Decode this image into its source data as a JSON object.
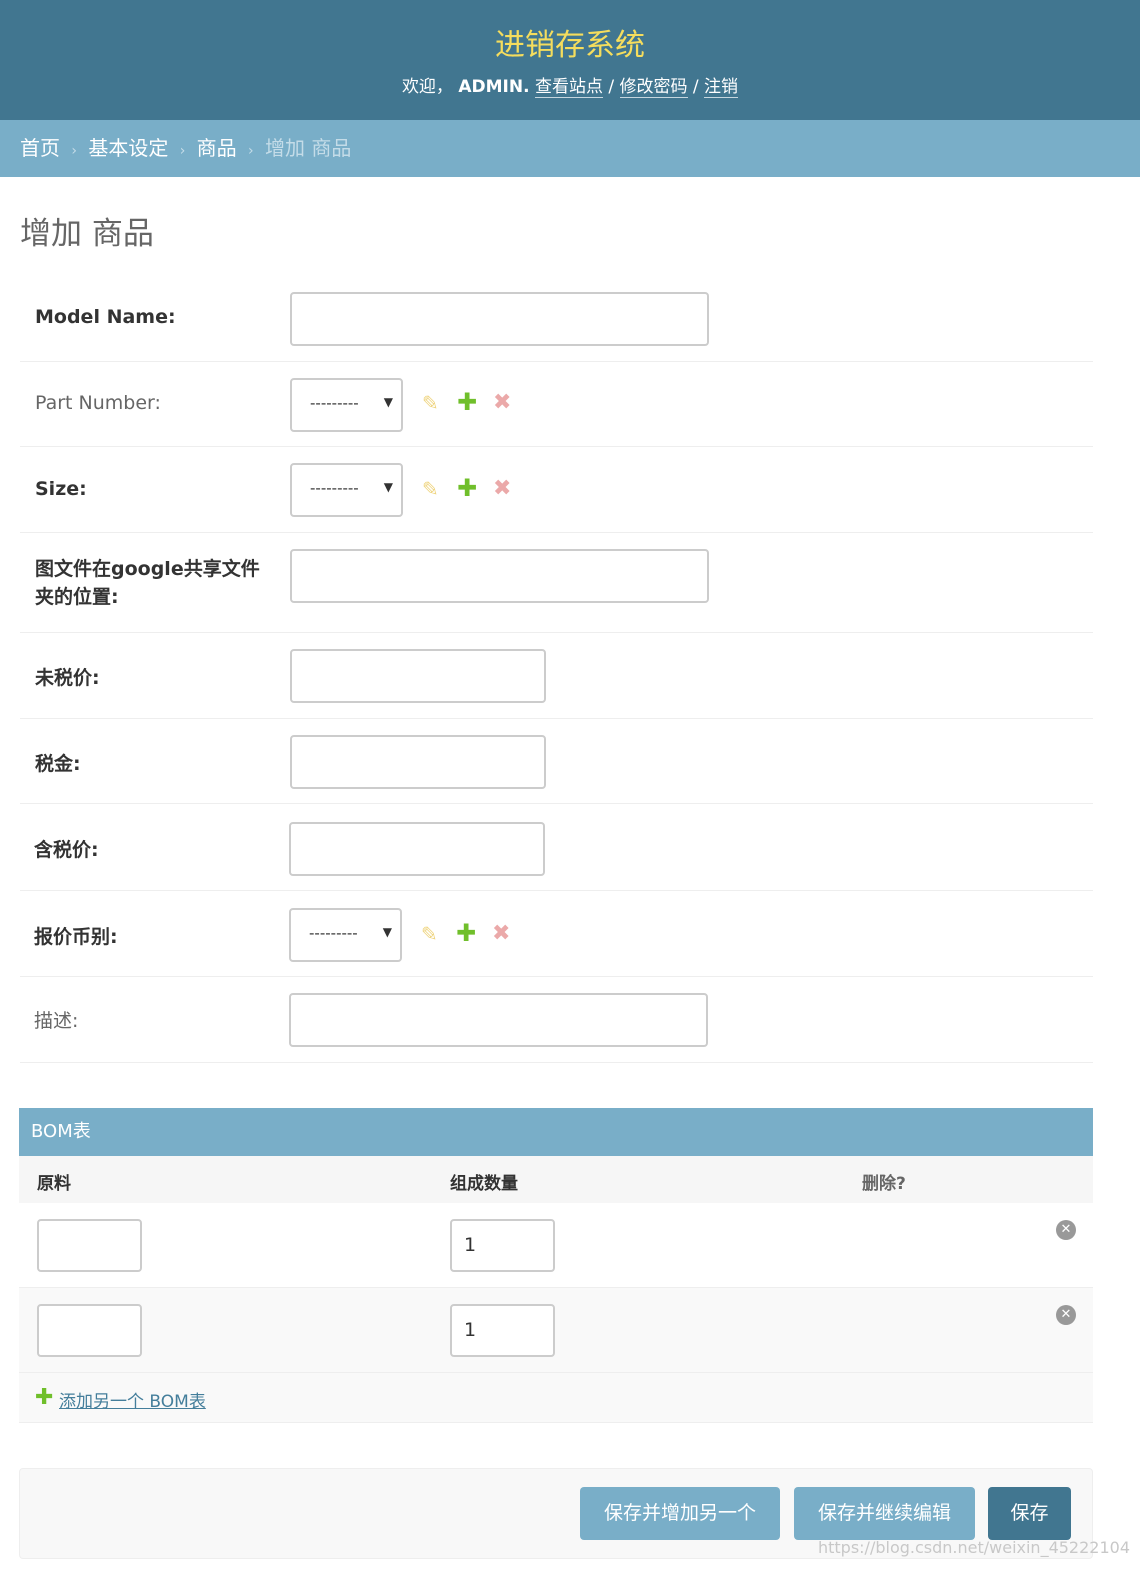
{
  "header": {
    "site_name": "进销存系统",
    "welcome": "欢迎，",
    "username": "ADMIN.",
    "links": [
      "查看站点",
      "修改密码",
      "注销"
    ],
    "separator": "/"
  },
  "breadcrumbs": {
    "items": [
      "首页",
      "基本设定",
      "商品"
    ],
    "current": "增加 商品",
    "sep": "›"
  },
  "page_title": "增加 商品",
  "form": {
    "model_name": "Model Name:",
    "part_number": "Part Number:",
    "size": "Size:",
    "file_location": "图文件在google共享文件夹的位置:",
    "price_pre_tax": "未税价:",
    "tax": "税金:",
    "price_with_tax": "含税价:",
    "currency": "报价币别:",
    "description": "描述:",
    "select_empty": "---------"
  },
  "icons": {
    "edit": "pencil-icon",
    "add": "plus-icon",
    "delete": "x-icon",
    "remove": "remove-circle-icon",
    "select_arrow": "▼",
    "plus": "✚",
    "x": "✖",
    "pencil": "✎",
    "close": "✕"
  },
  "inline": {
    "title": "BOM表",
    "col_material": "原料",
    "col_quantity": "组成数量",
    "col_delete": "删除?",
    "rows": [
      {
        "material": "",
        "quantity": "1"
      },
      {
        "material": "",
        "quantity": "1"
      }
    ],
    "add_another": "添加另一个 BOM表"
  },
  "buttons": {
    "save_add_another": "保存并增加另一个",
    "save_continue": "保存并继续编辑",
    "save": "保存"
  },
  "watermark": "https://blog.csdn.net/weixin_45222104",
  "colors": {
    "header_bg": "#417690",
    "site_title": "#f5dd5d",
    "breadcrumb_bg": "#79aec8",
    "link": "#447e9b"
  }
}
